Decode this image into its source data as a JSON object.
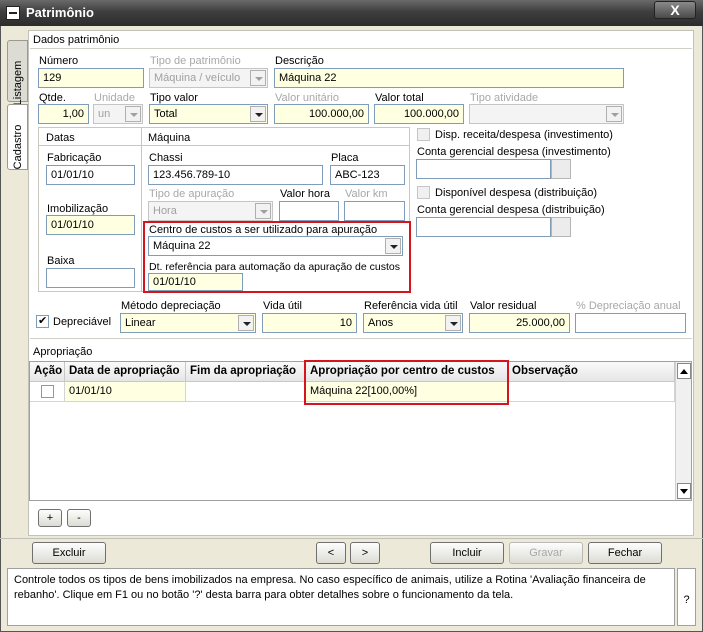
{
  "window": {
    "title": "Patrimônio",
    "close_glyph": "X"
  },
  "side_tabs": {
    "listagem": "Listagem",
    "cadastro": "Cadastro"
  },
  "dados": {
    "header": "Dados patrimônio",
    "numero": {
      "label": "Número",
      "value": "129"
    },
    "tipo_patrimonio": {
      "label": "Tipo de patrimônio",
      "value": "Máquina / veículo"
    },
    "descricao": {
      "label": "Descrição",
      "value": "Máquina 22"
    },
    "qtde": {
      "label": "Qtde.",
      "value": "1,00"
    },
    "unidade": {
      "label": "Unidade",
      "value": "un"
    },
    "tipo_valor": {
      "label": "Tipo valor",
      "value": "Total"
    },
    "valor_unitario": {
      "label": "Valor unitário",
      "value": "100.000,00"
    },
    "valor_total": {
      "label": "Valor total",
      "value": "100.000,00"
    },
    "tipo_atividade": {
      "label": "Tipo atividade",
      "value": ""
    }
  },
  "datas": {
    "header": "Datas",
    "fabricacao": {
      "label": "Fabricação",
      "value": "01/01/10"
    },
    "imobilizacao": {
      "label": "Imobilização",
      "value": "01/01/10"
    },
    "baixa": {
      "label": "Baixa",
      "value": ""
    }
  },
  "maquina": {
    "header": "Máquina",
    "chassi": {
      "label": "Chassi",
      "value": "123.456.789-10"
    },
    "placa": {
      "label": "Placa",
      "value": "ABC-123"
    },
    "tipo_apuracao": {
      "label": "Tipo de apuração",
      "value": "Hora"
    },
    "valor_hora": {
      "label": "Valor hora",
      "value": ""
    },
    "valor_km": {
      "label": "Valor km",
      "value": ""
    },
    "centro_custos": {
      "label": "Centro de custos a ser utilizado para apuração",
      "value": "Máquina 22"
    },
    "dt_referencia": {
      "label": "Dt. referência para automação da apuração de custos",
      "value": "01/01/10"
    }
  },
  "despesa": {
    "disp_receita": {
      "label": "Disp. receita/despesa (investimento)",
      "checked": false
    },
    "conta_invest": {
      "label": "Conta gerencial despesa (investimento)",
      "value": ""
    },
    "disp_despesa": {
      "label": "Disponível despesa (distribuição)",
      "checked": false
    },
    "conta_distrib": {
      "label": "Conta gerencial despesa (distribuição)",
      "value": ""
    }
  },
  "depreciacao": {
    "depreciavel": {
      "label": "Depreciável",
      "checked": true
    },
    "metodo": {
      "label": "Método depreciação",
      "value": "Linear"
    },
    "vida_util": {
      "label": "Vida útil",
      "value": "10"
    },
    "referencia": {
      "label": "Referência vida útil",
      "value": "Anos"
    },
    "valor_residual": {
      "label": "Valor residual",
      "value": "25.000,00"
    },
    "pct_anual": {
      "label": "% Depreciação anual",
      "value": ""
    }
  },
  "apropriacao": {
    "header": "Apropriação",
    "columns": [
      "Ação",
      "Data de apropriação",
      "Fim da apropriação",
      "Apropriação por centro de custos",
      "Observação"
    ],
    "rows": [
      {
        "data": "01/01/10",
        "fim": "",
        "centro": "Máquina  22[100,00%]",
        "obs": ""
      }
    ],
    "add": "+",
    "remove": "-"
  },
  "buttons": {
    "excluir": "Excluir",
    "prev": "<",
    "next": ">",
    "incluir": "Incluir",
    "gravar": "Gravar",
    "fechar": "Fechar"
  },
  "status": {
    "text": "Controle todos os tipos de bens imobilizados na empresa. No caso específico de animais, utilize a Rotina 'Avaliação financeira de rebanho'. Clique em F1 ou no botão '?' desta barra para obter detalhes sobre o funcionamento da tela.",
    "help": "?"
  }
}
